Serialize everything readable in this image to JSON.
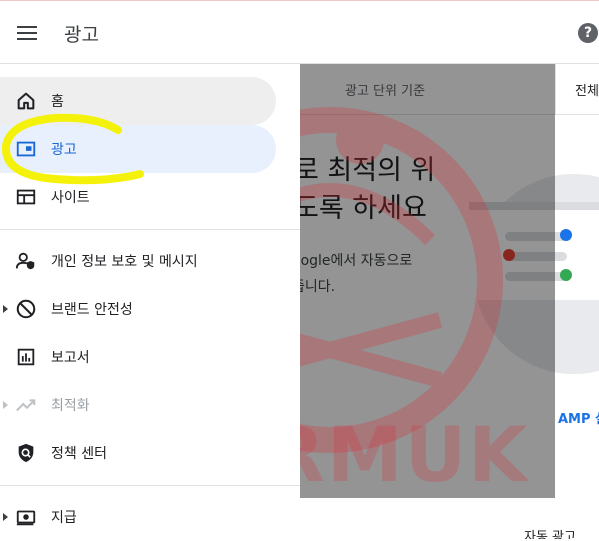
{
  "header": {
    "title": "광고",
    "help_symbol": "?"
  },
  "background": {
    "tab_label": "광고 단위 기준",
    "tab_label_2": "전체",
    "heading": "로 최적의 위\n도록 하세요",
    "body": "oogle에서 자동으로\n줍니다.",
    "amp_link": "AMP 실",
    "bottom_label": "자동 광고"
  },
  "watermark": {
    "text": "NARMUK"
  },
  "nav": {
    "items": [
      {
        "label": "홈",
        "icon": "home-icon",
        "state": "hover"
      },
      {
        "label": "광고",
        "icon": "ads-icon",
        "state": "active"
      },
      {
        "label": "사이트",
        "icon": "sites-icon",
        "state": "normal"
      },
      {
        "label": "개인 정보 보호 및 메시지",
        "icon": "privacy-icon",
        "state": "normal"
      },
      {
        "label": "브랜드 안전성",
        "icon": "block-icon",
        "state": "normal",
        "expandable": true
      },
      {
        "label": "보고서",
        "icon": "reports-icon",
        "state": "normal"
      },
      {
        "label": "최적화",
        "icon": "trending-icon",
        "state": "disabled",
        "expandable": true
      },
      {
        "label": "정책 센터",
        "icon": "policy-shield-icon",
        "state": "normal"
      },
      {
        "label": "지급",
        "icon": "payments-icon",
        "state": "normal",
        "expandable": true
      }
    ]
  },
  "colors": {
    "accent": "#1967d2",
    "active_bg": "#e8f0fe",
    "highlight_marker": "#f4f20a"
  }
}
